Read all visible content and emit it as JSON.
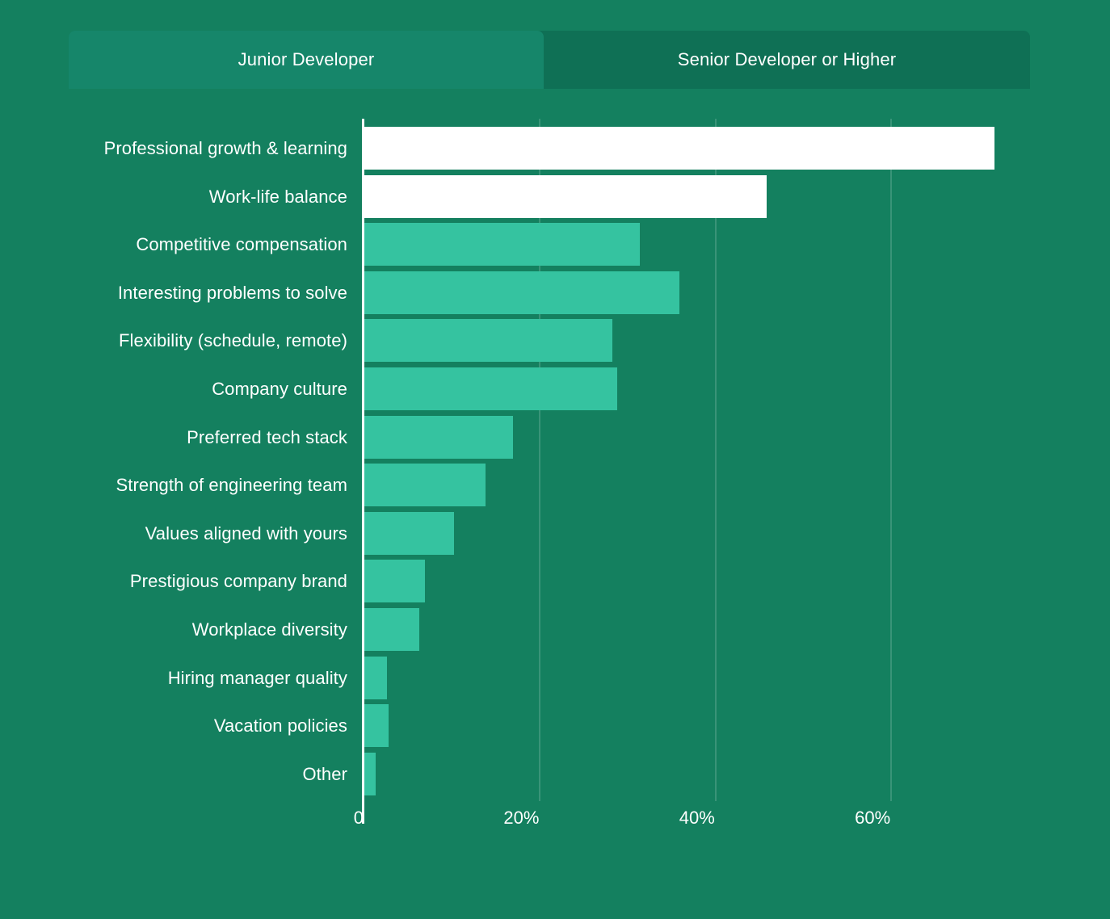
{
  "tabs": [
    {
      "label": "Junior Developer",
      "active": true
    },
    {
      "label": "Senior Developer or Higher",
      "active": false
    }
  ],
  "colors": {
    "background": "#14805F",
    "tab_bar": "#0F7055",
    "tab_active": "#16866A",
    "bar": "#35C3A0",
    "bar_highlight": "#FFFFFF",
    "axis": "#FFFFFF",
    "text": "#FFFFFF"
  },
  "chart_data": {
    "type": "bar",
    "orientation": "horizontal",
    "title": "",
    "subtitle": "",
    "xlabel": "",
    "ylabel": "",
    "xlim": [
      0,
      73
    ],
    "grid": true,
    "legend": null,
    "xticks": [
      "0",
      "20%",
      "40%",
      "60%"
    ],
    "xtick_values": [
      0,
      20,
      40,
      60
    ],
    "categories": [
      "Professional growth & learning",
      "Work-life balance",
      "Competitive compensation",
      "Interesting problems to solve",
      "Flexibility (schedule, remote)",
      "Company culture",
      "Preferred tech stack",
      "Strength of engineering team",
      "Values aligned with yours",
      "Prestigious company brand",
      "Workplace diversity",
      "Hiring manager quality",
      "Vacation policies",
      "Other"
    ],
    "values": [
      71.8,
      45.8,
      31.4,
      35.9,
      28.2,
      28.8,
      16.9,
      13.8,
      10.2,
      6.9,
      6.3,
      2.6,
      2.8,
      1.3
    ],
    "highlighted": [
      "Professional growth & learning",
      "Work-life balance"
    ]
  }
}
